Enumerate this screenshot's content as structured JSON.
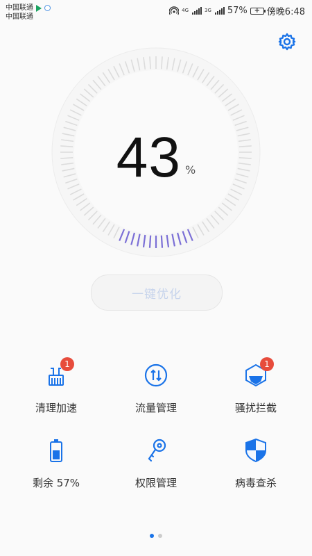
{
  "status_bar": {
    "carrier_1": "中国联通",
    "carrier_2": "中国联通",
    "net_1": "4G",
    "net_2": "3G",
    "battery_text": "57%",
    "time": "傍晚6:48"
  },
  "gauge": {
    "score": "43",
    "unit": "%",
    "accent": "#7b6fd6"
  },
  "actions": {
    "optimize_label": "一键优化"
  },
  "tiles": [
    {
      "name": "cleanup",
      "label": "清理加速",
      "badge": "1",
      "icon": "broom-icon"
    },
    {
      "name": "data-traffic",
      "label": "流量管理",
      "icon": "traffic-icon"
    },
    {
      "name": "block",
      "label": "骚扰拦截",
      "badge": "1",
      "icon": "shield-block-icon"
    },
    {
      "name": "battery",
      "label": "剩余 57%",
      "icon": "battery-icon"
    },
    {
      "name": "permissions",
      "label": "权限管理",
      "icon": "key-icon"
    },
    {
      "name": "virus-scan",
      "label": "病毒查杀",
      "icon": "shield-icon"
    }
  ],
  "pager": {
    "pages": 2,
    "active": 0
  },
  "colors": {
    "primary": "#1a73e8",
    "badge": "#e74c3c"
  }
}
